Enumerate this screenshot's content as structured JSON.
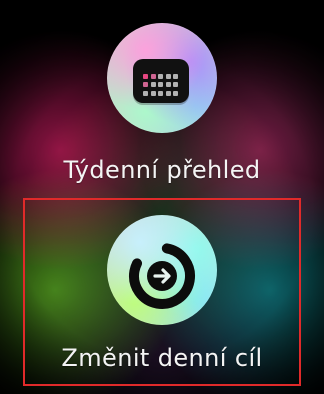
{
  "actions": {
    "weekly": {
      "label": "Týdenní přehled",
      "icon": "calendar-grid-icon"
    },
    "change_goal": {
      "label": "Změnit denní cíl",
      "icon": "circular-arrow-icon"
    }
  },
  "colors": {
    "highlight_frame": "#e02a2a",
    "background": "#000000",
    "label": "#f4f4f4"
  }
}
